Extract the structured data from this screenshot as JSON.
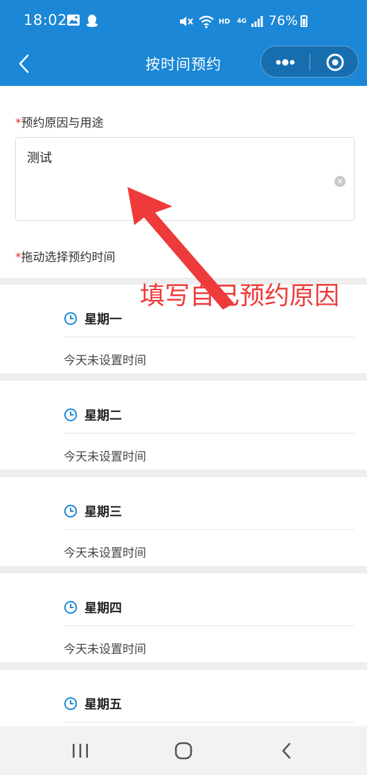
{
  "status_bar": {
    "time": "18:02",
    "network_label": "HD",
    "signal_label": "4G",
    "battery": "76%"
  },
  "nav": {
    "title": "按时间预约"
  },
  "form": {
    "reason_star": "*",
    "reason_label": "预约原因与用途",
    "reason_value": "测试",
    "time_star": "*",
    "time_label": "拖动选择预约时间"
  },
  "days": [
    {
      "name": "星期一",
      "status": "今天未设置时间"
    },
    {
      "name": "星期二",
      "status": "今天未设置时间"
    },
    {
      "name": "星期三",
      "status": "今天未设置时间"
    },
    {
      "name": "星期四",
      "status": "今天未设置时间"
    },
    {
      "name": "星期五",
      "status": ""
    }
  ],
  "annotation": {
    "text": "填写自己预约原因",
    "color": "#ee3a3a"
  },
  "colors": {
    "primary": "#1b87d6",
    "required": "#e0312a",
    "icon_blue": "#1b87d6"
  }
}
